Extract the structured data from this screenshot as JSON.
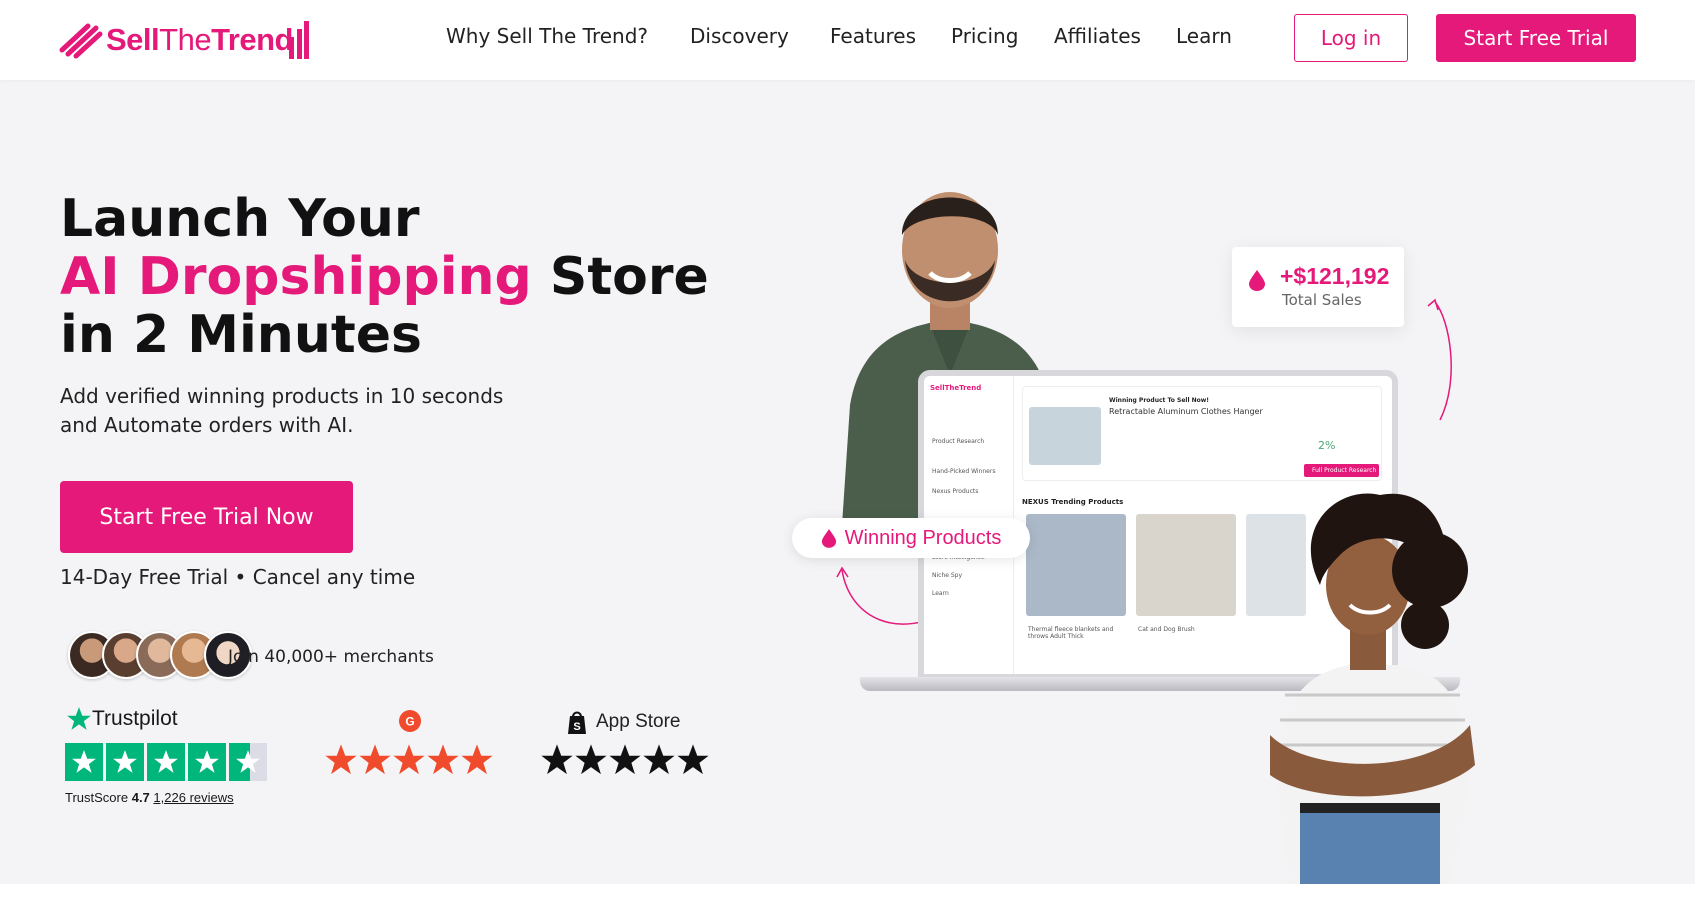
{
  "nav": {
    "logo": {
      "part1": "Sell",
      "part2": "The",
      "part3": "Trend"
    },
    "links": [
      "Why Sell The Trend?",
      "Discovery",
      "Features",
      "Pricing",
      "Affiliates",
      "Learn"
    ],
    "login_label": "Log in",
    "trial_label": "Start Free Trial"
  },
  "hero": {
    "headline_line1": "Launch Your",
    "headline_pink": "AI Dropshipping",
    "headline_line2_rest": "Store",
    "headline_line3": "in 2 Minutes",
    "sub_line1": "Add verified winning products in 10 seconds",
    "sub_line2": "and Automate orders with AI.",
    "cta_label": "Start Free Trial Now",
    "trial_note": "14-Day Free Trial • Cancel any time",
    "join_text": "Join 40,000+ merchants"
  },
  "ratings": {
    "trustpilot": {
      "name": "Trustpilot",
      "score_label": "TrustScore",
      "score": "4.7",
      "reviews": "1,226 reviews",
      "stars": 4.7
    },
    "g2": {
      "stars": 5
    },
    "appstore": {
      "name": "App Store",
      "stars": 5
    }
  },
  "visual": {
    "sales_value": "+$121,192",
    "sales_label": "Total Sales",
    "winning_label": "Winning Products",
    "laptop": {
      "headline": "Winning Product To Sell Now!",
      "product": "Retractable Aluminum Clothes Hanger",
      "trending": "NEXUS Trending Products",
      "item1": "Thermal fleece blankets and throws Adult Thick",
      "item2": "Cat and Dog Brush",
      "cta": "Full Product Research",
      "percent": "2%"
    }
  },
  "colors": {
    "brand": "#e5197a",
    "trustpilot": "#00b67a",
    "g2": "#ef4b2c",
    "hero_bg": "#f4f4f6"
  }
}
